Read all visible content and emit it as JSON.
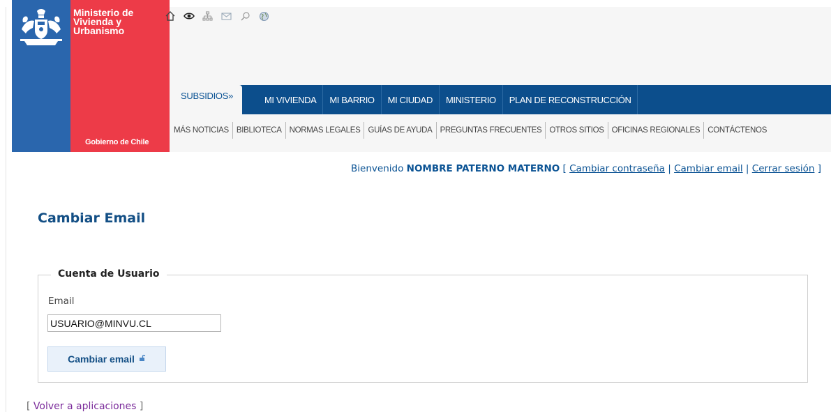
{
  "header": {
    "ministry_name": "Ministerio de\nVivienda y\nUrbanismo",
    "government_label": "Gobierno de Chile",
    "top_icons": [
      "home-icon",
      "eye-icon",
      "sitemap-icon",
      "mail-icon",
      "search-icon",
      "globe-icon"
    ]
  },
  "nav": {
    "subsidios_label": "SUBSIDIOS»",
    "items": [
      "MI VIVIENDA",
      "MI BARRIO",
      "MI CIUDAD",
      "MINISTERIO",
      "PLAN DE RECONSTRUCCIÓN"
    ]
  },
  "subnav": {
    "items": [
      "MÁS NOTICIAS",
      "BIBLIOTECA",
      "NORMAS LEGALES",
      "GUÍAS DE AYUDA",
      "PREGUNTAS FRECUENTES",
      "OTROS SITIOS",
      "OFICINAS REGIONALES",
      "CONTÁCTENOS"
    ]
  },
  "welcome": {
    "prefix": "Bienvenido",
    "user_name": "NOMBRE PATERNO MATERNO",
    "open_bracket": "[",
    "separator": "|",
    "close_bracket": "]",
    "change_password": "Cambiar contraseña",
    "change_email": "Cambiar email",
    "logout": "Cerrar sesión"
  },
  "page": {
    "title": "Cambiar Email"
  },
  "form": {
    "legend": "Cuenta de Usuario",
    "email_label": "Email",
    "email_value": "USUARIO@MINVU.CL",
    "submit_label": "Cambiar email"
  },
  "footer": {
    "open_bracket": "[",
    "back_label": "Volver a aplicaciones",
    "close_bracket": "]"
  },
  "colors": {
    "nav_blue": "#0c4e8c",
    "logo_blue": "#2a66ad",
    "logo_red": "#ed3b48",
    "title_blue": "#134f85",
    "visited_link": "#7a2a9a"
  }
}
